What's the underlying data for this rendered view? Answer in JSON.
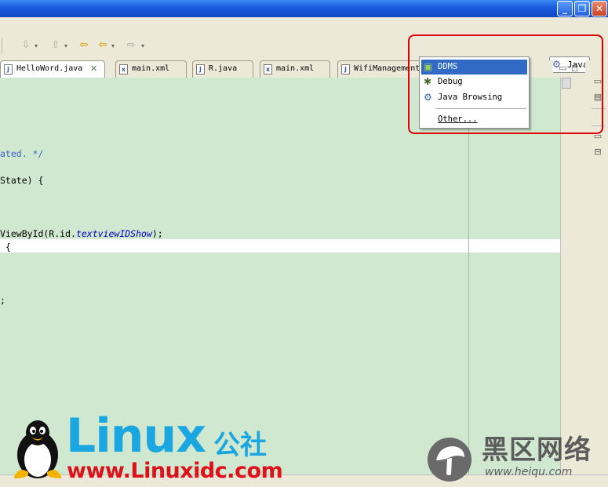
{
  "editor_tabs": [
    {
      "label": "HelloWord.java",
      "icon": "java-file-icon",
      "active": true
    },
    {
      "label": "main.xml",
      "icon": "xml-file-icon",
      "active": false
    },
    {
      "label": "R.java",
      "icon": "java-file-icon",
      "active": false
    },
    {
      "label": "main.xml",
      "icon": "xml-file-icon",
      "active": false
    },
    {
      "label": "WifiManagement",
      "icon": "java-file-icon",
      "active": false
    }
  ],
  "perspective": {
    "current_label": "Java",
    "menu": [
      {
        "label": "DDMS",
        "icon": "android-icon",
        "selected": true
      },
      {
        "label": "Debug",
        "icon": "debug-bug-icon",
        "selected": false
      },
      {
        "label": "Java Browsing",
        "icon": "java-browsing-icon",
        "selected": false
      },
      {
        "label": "Other...",
        "icon": "",
        "selected": false
      }
    ]
  },
  "code_lines": [
    {
      "text": "ated. */"
    },
    {
      "text": "State) {"
    },
    {
      "text_before": "ViewById(R.id.",
      "field": "textviewIDShow",
      "text_after": ");"
    },
    {
      "text": " {"
    },
    {
      "text": ";"
    }
  ],
  "watermark": {
    "brand": "Linux",
    "brand_cn": "公社",
    "url": "www.Linuxidc.com",
    "heiqu_cn": "黑区网络",
    "heiqu_url": "www.heiqu.com"
  },
  "colors": {
    "editor_bg": "#cfe8cf",
    "selection": "#316ac5",
    "highlight_frame": "#e00000",
    "linux_blue": "#1aa6e0",
    "url_red": "#e0101a"
  }
}
